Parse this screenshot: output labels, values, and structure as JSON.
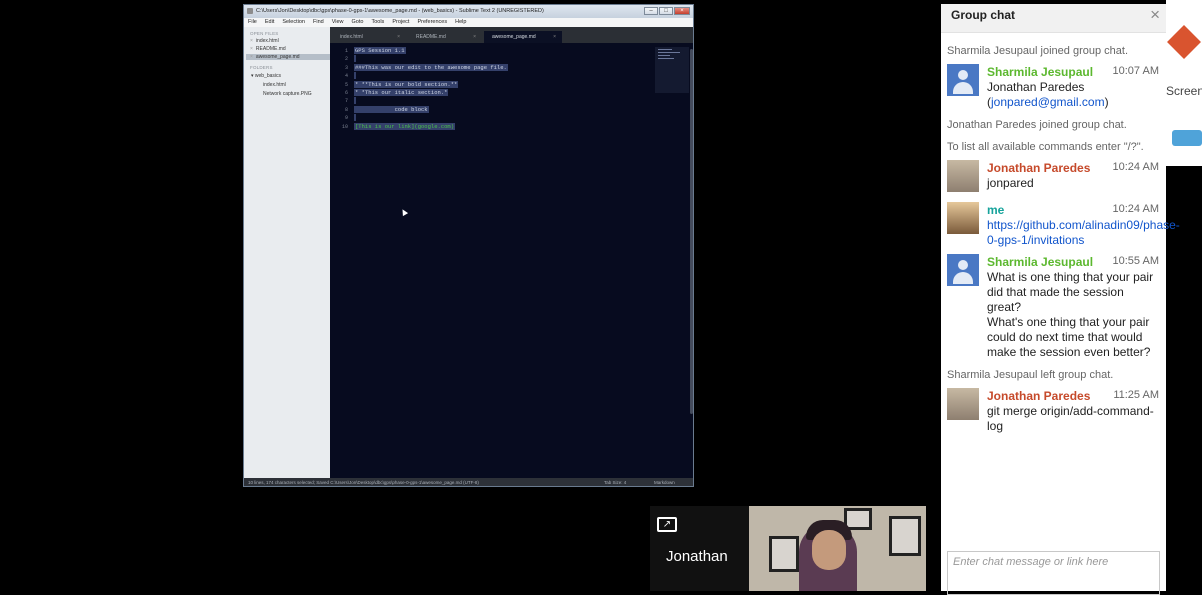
{
  "editor": {
    "title": "C:\\Users\\Jon\\Desktop\\dbc\\gps\\phase-0-gps-1\\awesome_page.md - (web_basics) - Sublime Text 2 (UNREGISTERED)",
    "menu": [
      "File",
      "Edit",
      "Selection",
      "Find",
      "View",
      "Goto",
      "Tools",
      "Project",
      "Preferences",
      "Help"
    ],
    "sidebar": {
      "open_files_header": "OPEN FILES",
      "open_files": [
        "index.html",
        "README.md",
        "awesome_page.md"
      ],
      "folders_header": "FOLDERS",
      "folder": "web_basics",
      "folder_files": [
        "index.html",
        "Network capture.PNG"
      ]
    },
    "tabs": [
      "index.html",
      "README.md",
      "awesome_page.md"
    ],
    "line_numbers": [
      "1",
      "2",
      "3",
      "4",
      "5",
      "6",
      "7",
      "8",
      "9",
      "10"
    ],
    "code_lines": [
      "GPS Session 1.1",
      "",
      "###This was our edit to the awesome page file.",
      "",
      "* **This is our bold section.**",
      "* *This our italic section.*",
      "",
      "            code block",
      "",
      "[This is our link](google.com)"
    ],
    "status_left": "10 lines, 174 characters selected; Saved C:\\Users\\Jon\\Desktop\\dbc\\gps\\phase-0-gps-1\\awesome_page.md (UTF-8)",
    "status_tab": "Tab Size: 4",
    "status_syntax": "Markdown"
  },
  "video": {
    "name": "Jonathan"
  },
  "chat": {
    "title": "Group chat",
    "close": "×",
    "input_placeholder": "Enter chat message or link here",
    "items": [
      {
        "kind": "sys",
        "text": "Sharmila Jesupaul joined group chat."
      },
      {
        "kind": "msg",
        "name": "Sharmila Jesupaul",
        "time": "10:07 AM",
        "color": "#5cb82f",
        "avatar": "default",
        "lines": [
          "Jonathan Paredes (jonpared@gmail.com)"
        ]
      },
      {
        "kind": "sys",
        "text": "Jonathan Paredes joined group chat."
      },
      {
        "kind": "sys",
        "text": "To list all available commands enter \"/?\"."
      },
      {
        "kind": "msg",
        "name": "Jonathan Paredes",
        "time": "10:24 AM",
        "color": "#c64a2b",
        "avatar": "jon",
        "lines": [
          "jonpared"
        ]
      },
      {
        "kind": "msg",
        "name": "me",
        "time": "10:24 AM",
        "color": "#16a39b",
        "avatar": "me",
        "lines": [
          "https://github.com/alinadin09/phase-0-gps-1/invitations"
        ]
      },
      {
        "kind": "msg",
        "name": "Sharmila Jesupaul",
        "time": "10:55 AM",
        "color": "#5cb82f",
        "avatar": "default",
        "lines": [
          "What is one thing that your pair did that made the session great?",
          "What's one thing that your pair could do next time that would make the session even better?"
        ]
      },
      {
        "kind": "sys",
        "text": "Sharmila Jesupaul left group chat."
      },
      {
        "kind": "msg",
        "name": "Jonathan Paredes",
        "time": "11:25 AM",
        "color": "#c64a2b",
        "avatar": "jon",
        "lines": [
          "git merge origin/add-command-log"
        ]
      }
    ]
  },
  "right_edge": {
    "label": "Screen"
  }
}
